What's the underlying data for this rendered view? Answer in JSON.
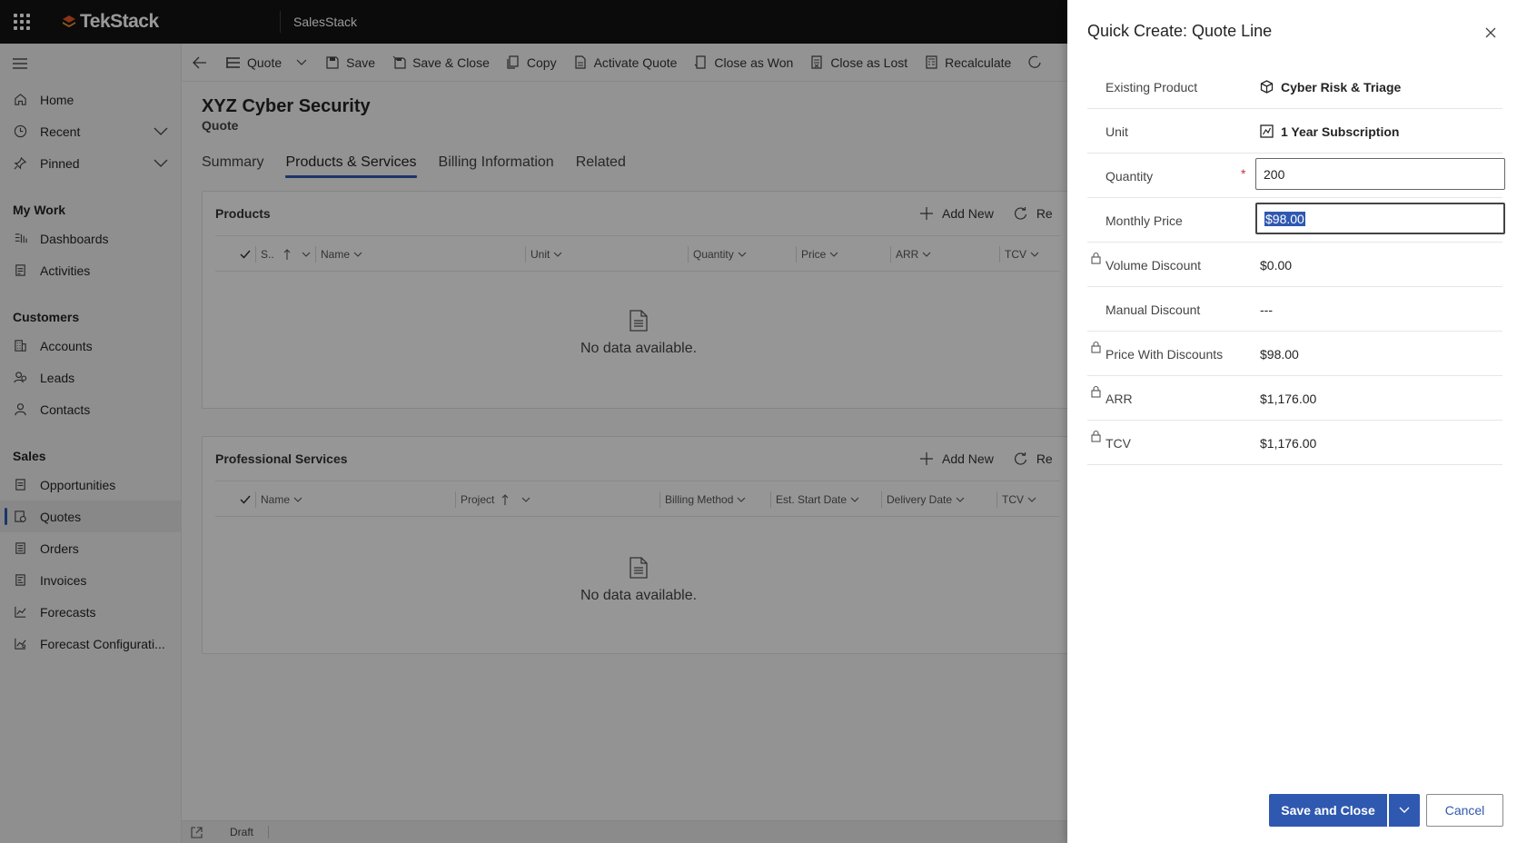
{
  "topbar": {
    "brand": "TekStack",
    "app_name": "SalesStack"
  },
  "sidebar": {
    "items_top": [
      {
        "label": "Home",
        "icon": "home-icon"
      },
      {
        "label": "Recent",
        "icon": "clock-icon",
        "expandable": true
      },
      {
        "label": "Pinned",
        "icon": "pin-icon",
        "expandable": true
      }
    ],
    "sections": [
      {
        "title": "My Work",
        "items": [
          {
            "label": "Dashboards",
            "icon": "dashboard-icon"
          },
          {
            "label": "Activities",
            "icon": "activities-icon"
          }
        ]
      },
      {
        "title": "Customers",
        "items": [
          {
            "label": "Accounts",
            "icon": "accounts-icon"
          },
          {
            "label": "Leads",
            "icon": "leads-icon"
          },
          {
            "label": "Contacts",
            "icon": "contacts-icon"
          }
        ]
      },
      {
        "title": "Sales",
        "items": [
          {
            "label": "Opportunities",
            "icon": "opportunities-icon"
          },
          {
            "label": "Quotes",
            "icon": "quotes-icon",
            "active": true
          },
          {
            "label": "Orders",
            "icon": "orders-icon"
          },
          {
            "label": "Invoices",
            "icon": "invoices-icon"
          },
          {
            "label": "Forecasts",
            "icon": "forecasts-icon"
          },
          {
            "label": "Forecast Configurati...",
            "icon": "forecast-config-icon"
          }
        ]
      }
    ]
  },
  "commandbar": {
    "items": [
      "Quote",
      "Save",
      "Save & Close",
      "Copy",
      "Activate Quote",
      "Close as Won",
      "Close as Lost",
      "Recalculate"
    ]
  },
  "record": {
    "title": "XYZ Cyber Security",
    "type": "Quote",
    "tabs": [
      "Summary",
      "Products & Services",
      "Billing Information",
      "Related"
    ],
    "active_tab": "Products & Services"
  },
  "products": {
    "title": "Products",
    "add_new": "Add New",
    "refresh": "Re",
    "columns": [
      "S..",
      "Name",
      "Unit",
      "Quantity",
      "Price",
      "ARR",
      "TCV"
    ],
    "empty": "No data available."
  },
  "services": {
    "title": "Professional Services",
    "add_new": "Add New",
    "refresh": "Re",
    "columns": [
      "Name",
      "Project",
      "Billing Method",
      "Est. Start Date",
      "Delivery Date",
      "TCV"
    ],
    "empty": "No data available."
  },
  "footer": {
    "status": "Draft"
  },
  "quick_create": {
    "title": "Quick Create: Quote Line",
    "fields": {
      "existing_product": {
        "label": "Existing Product",
        "value": "Cyber Risk & Triage"
      },
      "unit": {
        "label": "Unit",
        "value": "1 Year Subscription"
      },
      "quantity": {
        "label": "Quantity",
        "value": "200",
        "required_mark": "*"
      },
      "monthly_price": {
        "label": "Monthly Price",
        "value": "$98.00"
      },
      "volume_discount": {
        "label": "Volume Discount",
        "value": "$0.00"
      },
      "manual_discount": {
        "label": "Manual Discount",
        "value": "---"
      },
      "price_with_discounts": {
        "label": "Price With Discounts",
        "value": "$98.00"
      },
      "arr": {
        "label": "ARR",
        "value": "$1,176.00"
      },
      "tcv": {
        "label": "TCV",
        "value": "$1,176.00"
      }
    },
    "save_label": "Save and Close",
    "cancel_label": "Cancel"
  },
  "colors": {
    "accent": "#2f58b0",
    "topbar": "#131313"
  }
}
